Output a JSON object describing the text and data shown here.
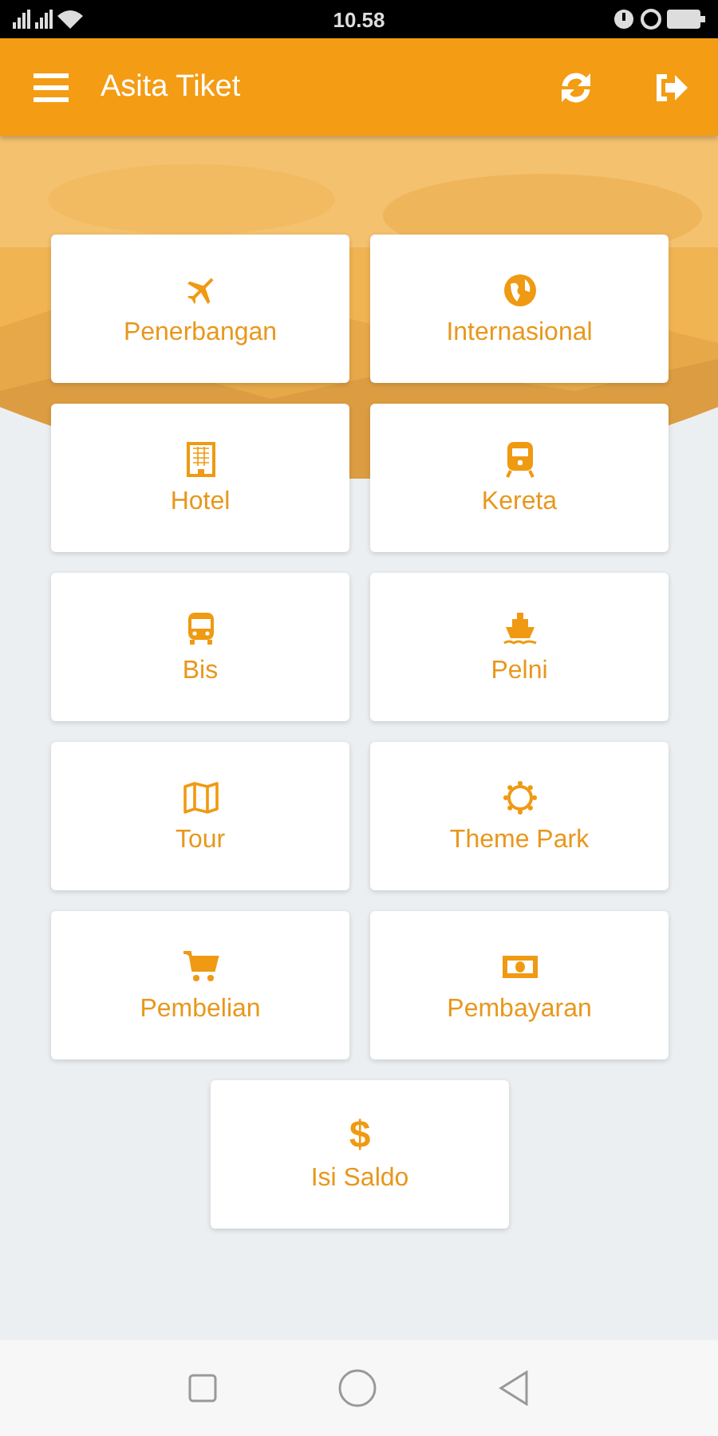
{
  "status_bar": {
    "time": "10.58"
  },
  "app_bar": {
    "title": "Asita Tiket"
  },
  "menu": [
    {
      "label": "Penerbangan",
      "kind": "plane"
    },
    {
      "label": "Internasional",
      "kind": "globe"
    },
    {
      "label": "Hotel",
      "kind": "building"
    },
    {
      "label": "Kereta",
      "kind": "train"
    },
    {
      "label": "Bis",
      "kind": "bus"
    },
    {
      "label": "Pelni",
      "kind": "ship"
    },
    {
      "label": "Tour",
      "kind": "map"
    },
    {
      "label": "Theme Park",
      "kind": "sun"
    },
    {
      "label": "Pembelian",
      "kind": "cart"
    },
    {
      "label": "Pembayaran",
      "kind": "money"
    },
    {
      "label": "Isi Saldo",
      "kind": "symbol",
      "symbol": "$"
    }
  ]
}
